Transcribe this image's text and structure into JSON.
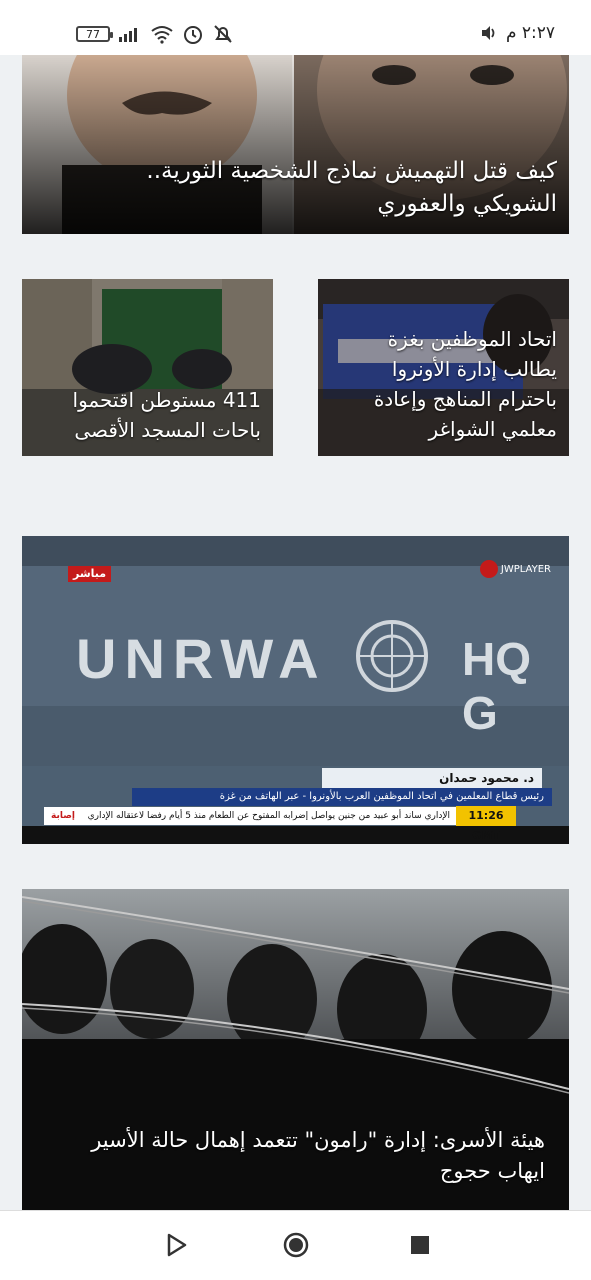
{
  "status_bar": {
    "battery": "77",
    "time": "٢:٢٧ م",
    "icons": [
      "signal-icon",
      "wifi-icon",
      "alarm-icon",
      "notifications-off-icon",
      "volume-icon"
    ]
  },
  "articles": [
    {
      "title_line1": "كيف قتل التهميش نماذج الشخصية الثورية..",
      "title_line2": "الشويكي والعفوري"
    },
    {
      "title_line1": "اتحاد الموظفين بغزة",
      "title_line2": "يطالب إدارة الأونروا",
      "title_line3": "باحترام المناهج وإعادة",
      "title_line4": "معلمي الشواغر"
    },
    {
      "title_line1": "411 مستوطن اقتحموا",
      "title_line2": "باحات المسجد الأقصى"
    },
    {
      "video": {
        "live_label": "مباشر",
        "player_label": "JWPLAYER",
        "wall_text": "UNRWA",
        "wall_text2": "HQ G",
        "speaker_name": "د. محمود حمدان",
        "speaker_title": "رئيس قطاع المعلمين في اتحاد الموظفين العرب بالأونروا - عبر الهاتف من غزة",
        "time_badge": "11:26 GMT",
        "ticker": "الإداري ساند أبو عبيد من جنين يواصل إضرابه المفتوح عن الطعام منذ 5 أيام رفضا لاعتقاله الإداري",
        "ticker_tag": "إصابة"
      }
    },
    {
      "title_line1": "هيئة الأسرى: إدارة \"رامون\" تتعمد إهمال حالة الأسير",
      "title_line2": "ايهاب حجوج"
    }
  ],
  "nav": {
    "icons": [
      "back-icon",
      "home-icon",
      "recents-icon"
    ]
  }
}
